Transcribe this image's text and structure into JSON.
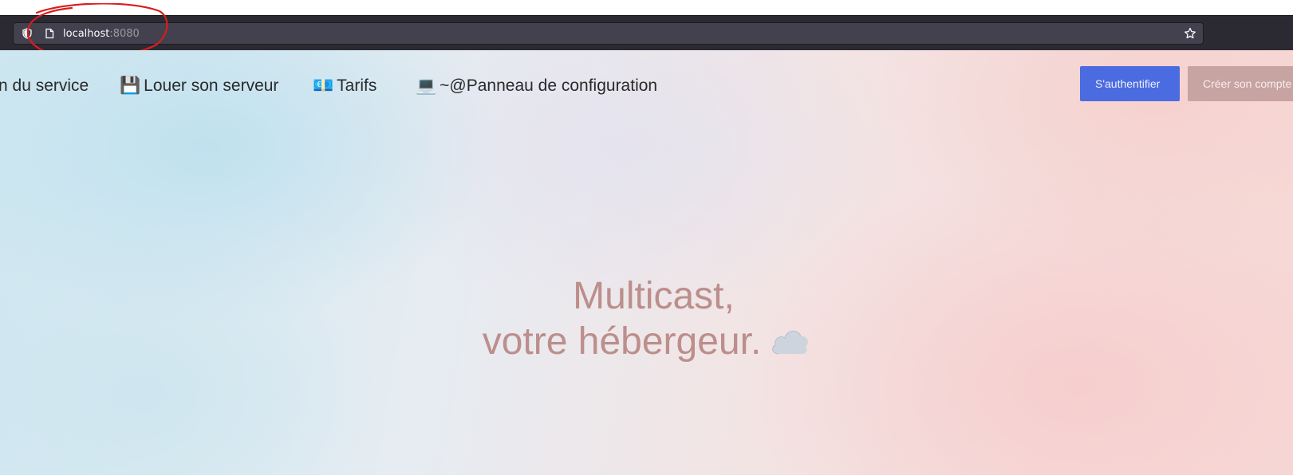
{
  "browser": {
    "url_host": "localhost",
    "url_port": ":8080",
    "icons": {
      "security": "shield-icon",
      "page": "page-icon",
      "bookmark": "star-icon"
    }
  },
  "annotation": {
    "color": "#d81e1e"
  },
  "nav": {
    "items": [
      {
        "emoji": "",
        "label": "n du service"
      },
      {
        "emoji": "💾",
        "label": "Louer son serveur"
      },
      {
        "emoji": "💶",
        "label": "Tarifs"
      },
      {
        "emoji": "💻",
        "label": "~@Panneau de configuration"
      }
    ]
  },
  "auth": {
    "login_label": "S'authentifier",
    "signup_label": "Créer son compte"
  },
  "hero": {
    "line1": "Multicast,",
    "line2": "votre hébergeur.",
    "icon": "cloud-icon"
  },
  "colors": {
    "login_button": "#4b6be0",
    "signup_button": "#c7a3a1",
    "hero_text": "#bc8e8c"
  }
}
